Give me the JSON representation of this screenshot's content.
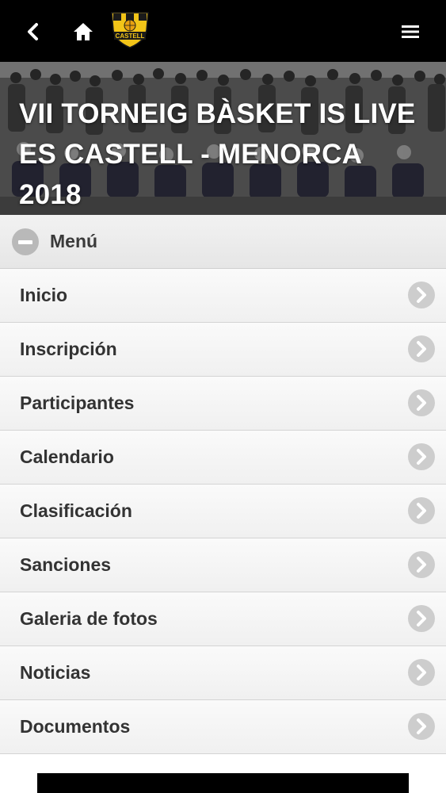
{
  "header": {
    "back_icon": "chevron-left-icon",
    "home_icon": "home-icon",
    "menu_icon": "hamburger-menu-icon",
    "logo_text": "CASTELL",
    "logo_letters": "C B C",
    "background": "#000000",
    "logo_color": "#f2c418"
  },
  "banner": {
    "title": "VII TORNEIG BÀSKET IS LIVE ES CASTELL - MENORCA 2018"
  },
  "menu": {
    "header_label": "Menú",
    "toggle_icon": "minus-circle-icon",
    "item_icon": "chevron-right-circle-icon",
    "items": [
      {
        "label": "Inicio"
      },
      {
        "label": "Inscripción"
      },
      {
        "label": "Participantes"
      },
      {
        "label": "Calendario"
      },
      {
        "label": "Clasificación"
      },
      {
        "label": "Sanciones"
      },
      {
        "label": "Galeria de fotos"
      },
      {
        "label": "Noticias"
      },
      {
        "label": "Documentos"
      }
    ]
  }
}
